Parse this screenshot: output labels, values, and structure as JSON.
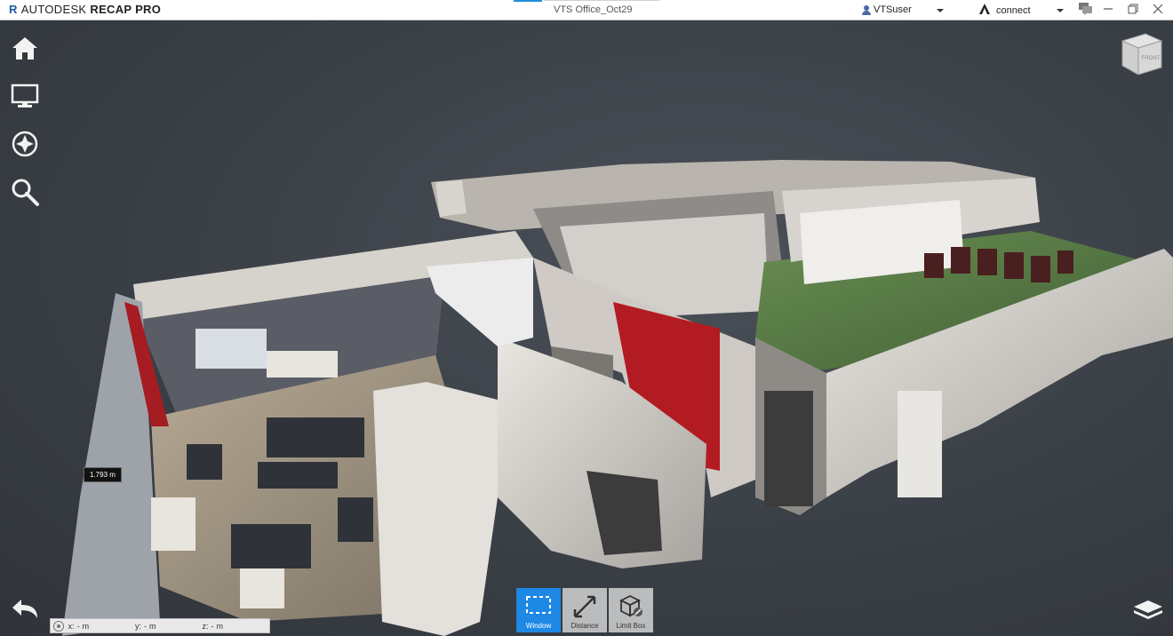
{
  "app": {
    "brand_prefix": "AUTODESK",
    "brand_product": "RECAP PRO",
    "document_title": "VTS Office_Oct29"
  },
  "header": {
    "user_name": "VTSuser",
    "connect_label": "connect"
  },
  "viewcube": {
    "face_label": "FRONT"
  },
  "scene": {
    "measurement_label": "1.793 m"
  },
  "coordinates": {
    "x_label": "x:",
    "x_value": "-",
    "x_unit": "m",
    "y_label": "y:",
    "y_value": "-",
    "y_unit": "m",
    "z_label": "z:",
    "z_value": "-",
    "z_unit": "m"
  },
  "toolbar": {
    "tools": [
      {
        "label": "Window",
        "active": true
      },
      {
        "label": "Distance",
        "active": false
      },
      {
        "label": "Limit Box",
        "active": false
      }
    ]
  },
  "colors": {
    "accent": "#1e88e5",
    "background": "#3a3f46",
    "brand_blue": "#1b5aa6"
  },
  "icons": [
    "home-icon",
    "display-icon",
    "compass-icon",
    "search-icon",
    "back-arrow-icon",
    "layers-icon",
    "chat-icon"
  ]
}
